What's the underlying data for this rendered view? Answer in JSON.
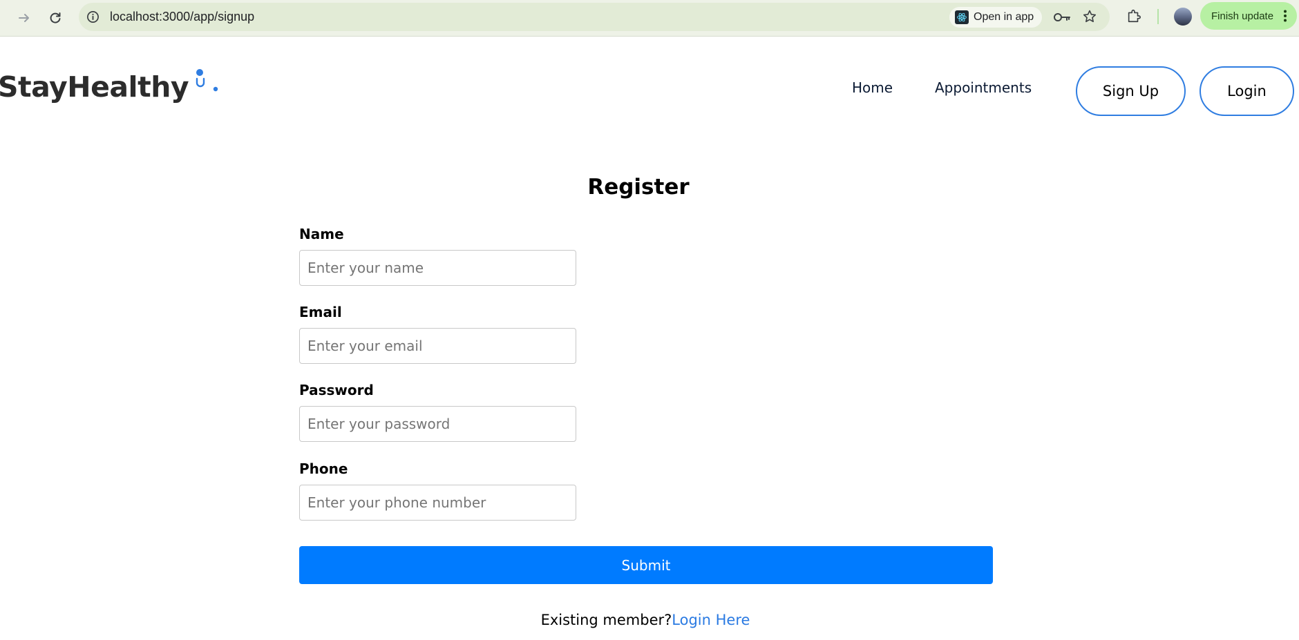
{
  "browser": {
    "url": "localhost:3000/app/signup",
    "open_in_app_label": "Open in app",
    "finish_update_label": "Finish update"
  },
  "site": {
    "logo_text": "StayHealthy",
    "nav": {
      "home": "Home",
      "appointments": "Appointments"
    },
    "signup_button": "Sign Up",
    "login_button": "Login",
    "accent_color": "#2f7de1"
  },
  "form": {
    "title": "Register",
    "fields": [
      {
        "label": "Name",
        "placeholder": "Enter your name",
        "type": "text"
      },
      {
        "label": "Email",
        "placeholder": "Enter your email",
        "type": "email"
      },
      {
        "label": "Password",
        "placeholder": "Enter your password",
        "type": "password"
      },
      {
        "label": "Phone",
        "placeholder": "Enter your phone number",
        "type": "tel"
      }
    ],
    "submit_label": "Submit",
    "submit_color": "#007bff",
    "existing_member_text": "Existing member?",
    "login_here_label": "Login Here"
  }
}
